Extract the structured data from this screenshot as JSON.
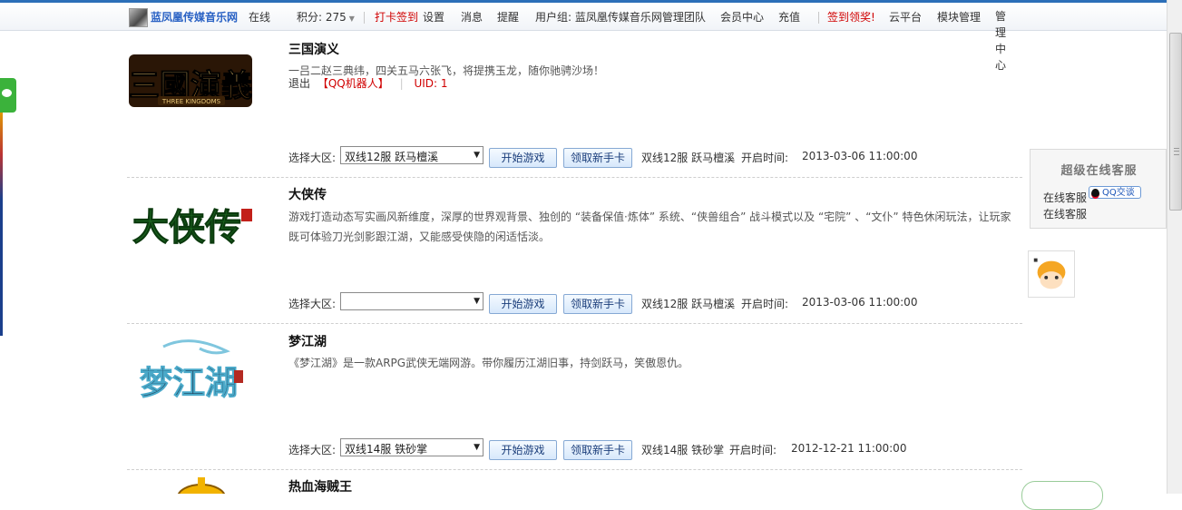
{
  "topbar": {
    "site_name": "蓝凤凰传媒音乐网",
    "online": "在线",
    "points": "积分: 275",
    "checkin": "打卡签到",
    "settings": "设置",
    "messages": "消息",
    "reminders": "提醒",
    "user_group": "用户组: 蓝凤凰传媒音乐网管理团队",
    "member_center": "会员中心",
    "recharge": "充值",
    "sign_reward": "签到领奖!",
    "cloud": "云平台",
    "module_mgmt": "模块管理",
    "admin_center": "管理中心"
  },
  "games": [
    {
      "title": "三国演义",
      "desc": "一吕二赵三典纬，四关五马六张飞，将提携玉龙，随你驰骋沙场！",
      "extra": {
        "logout": "退出",
        "bot": "【QQ机器人】",
        "uid": "UID: 1"
      },
      "logo_text": "三國演義",
      "logo_sub": "THREE KINGDOMS",
      "server_label": "选择大区:",
      "server_selected": "双线12服 跃马檀溪",
      "start_btn": "开始游戏",
      "card_btn": "领取新手卡",
      "server_info": "双线12服 跃马檀溪",
      "open_label": "开启时间:",
      "open_time": "2013-03-06 11:00:00"
    },
    {
      "title": "大侠传",
      "desc": "游戏打造动态写实画风新维度，深厚的世界观背景、独创的 “装备保值·炼体” 系统、“侠兽组合” 战斗模式以及 “宅院” 、“文仆” 特色休闲玩法，让玩家既可体验刀光剑影跟江湖，又能感受侠隐的闲适恬淡。",
      "logo_text": "大侠传",
      "server_label": "选择大区:",
      "server_selected": "",
      "start_btn": "开始游戏",
      "card_btn": "领取新手卡",
      "server_info": "双线12服 跃马檀溪",
      "open_label": "开启时间:",
      "open_time": "2013-03-06 11:00:00"
    },
    {
      "title": "梦江湖",
      "desc": "《梦江湖》是一款ARPG武侠无端网游。带你履历江湖旧事，持剑跃马，笑傲恩仇。",
      "logo_text": "梦江湖",
      "server_label": "选择大区:",
      "server_selected": "双线14服 铁砂掌",
      "start_btn": "开始游戏",
      "card_btn": "领取新手卡",
      "server_info": "双线14服 铁砂掌",
      "open_label": "开启时间:",
      "open_time": "2012-12-21 11:00:00"
    },
    {
      "title": "热血海贼王"
    }
  ],
  "service": {
    "heading": "超级在线客服",
    "line1": "在线客服",
    "qq_label": "QQ交谈",
    "line2": "在线客服"
  },
  "colors": {
    "accent_blue": "#2a62c4",
    "alert_red": "#d00000"
  }
}
